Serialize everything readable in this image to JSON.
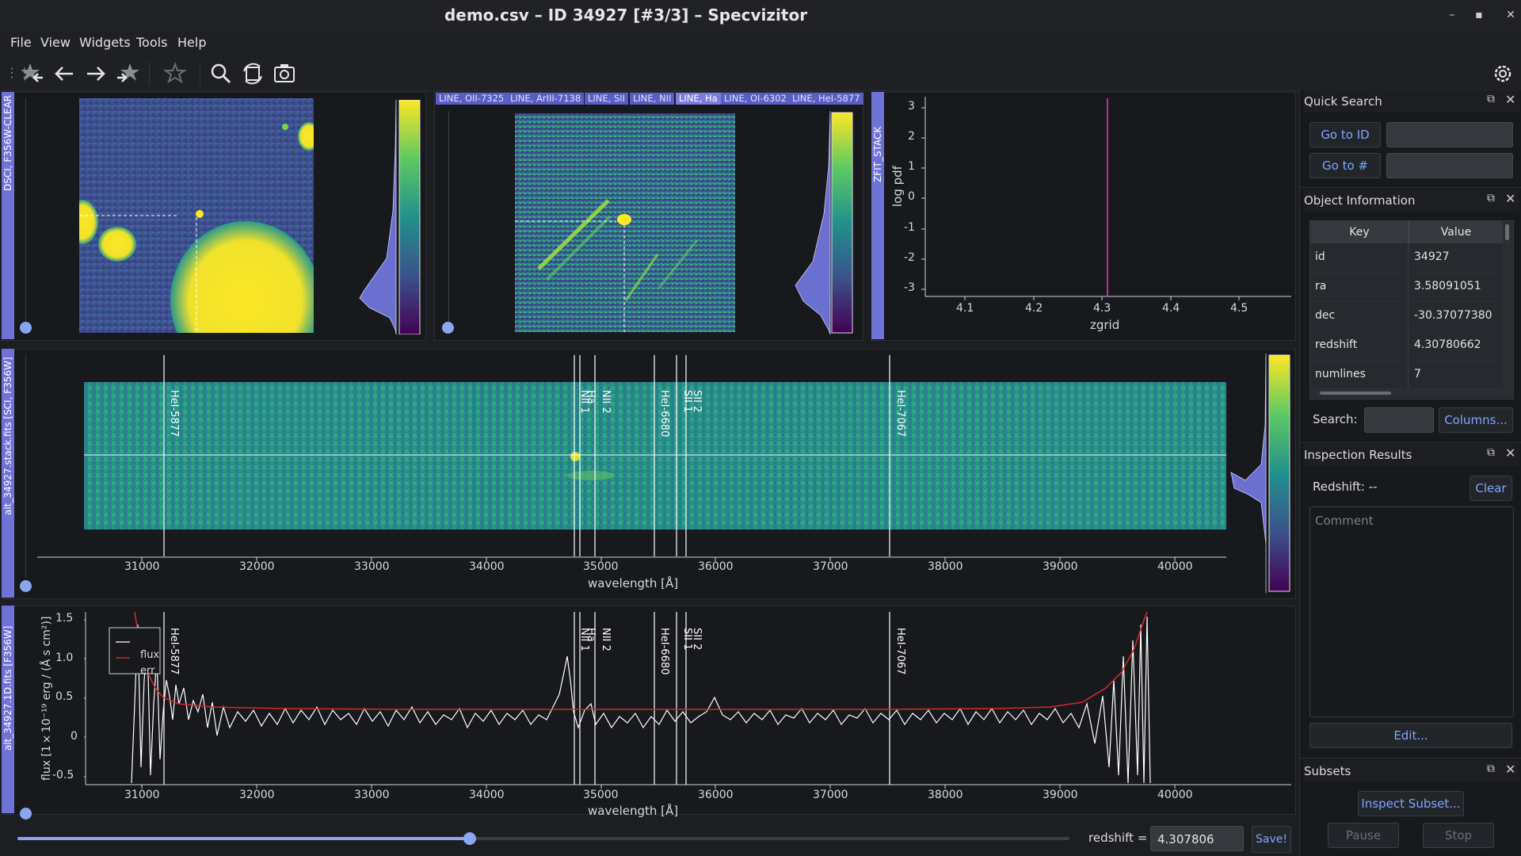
{
  "window": {
    "title": "demo.csv – ID 34927 [#3/3] – Specvizitor"
  },
  "menu": [
    "File",
    "View",
    "Widgets",
    "Tools",
    "Help"
  ],
  "toolbar": {
    "icons": [
      "first-star-icon",
      "back-icon",
      "forward-icon",
      "last-star-icon",
      "star-icon",
      "search-icon",
      "reset-view-icon",
      "screenshot-icon",
      "settings-icon"
    ]
  },
  "image1": {
    "label": "DSCI, F356W-CLEAR"
  },
  "image2": {
    "tabs": [
      "LINE, OII-7325",
      "LINE, ArIII-7138",
      "LINE, SII",
      "LINE, NII",
      "LINE, Ha",
      "LINE, OI-6302",
      "LINE, HeI-5877"
    ],
    "active_tab": "LINE, Ha"
  },
  "zfit": {
    "label": "ZFIT_STACK",
    "ylabel": "log pdf",
    "xlabel": "zgrid",
    "yticks": [
      "3",
      "2",
      "1",
      "0",
      "-1",
      "-2",
      "-3"
    ],
    "xticks": [
      "4.1",
      "4.2",
      "4.3",
      "4.4",
      "4.5"
    ]
  },
  "spec2d": {
    "label": "alt_34927.stack.fits [SCI, F356W]",
    "xlabel": "wavelength [Å]",
    "xticks": [
      "31000",
      "32000",
      "33000",
      "34000",
      "35000",
      "36000",
      "37000",
      "38000",
      "39000",
      "40000"
    ],
    "lines": [
      "HeI-5877",
      "NII 1",
      "Ha",
      "NII 2",
      "HeI-6680",
      "SII 1",
      "SII 2",
      "HeI-7067"
    ]
  },
  "spec1d": {
    "label": "alt_34927.1D.fits [F356W]",
    "ylabel": "flux [1×10⁻¹⁹ erg / (Å s cm²)]",
    "xlabel": "wavelength [Å]",
    "yticks": [
      "1.5",
      "1.0",
      "0.5",
      "0",
      "-0.5"
    ],
    "xticks": [
      "31000",
      "32000",
      "33000",
      "34000",
      "35000",
      "36000",
      "37000",
      "38000",
      "39000",
      "40000"
    ],
    "legend": [
      "flux",
      "err"
    ],
    "lines": [
      "HeI-5877",
      "NII 1",
      "Ha",
      "NII 2",
      "HeI-6680",
      "SII 1",
      "SII 2",
      "HeI-7067"
    ]
  },
  "bottom": {
    "redshift_label": "redshift =",
    "redshift_value": "4.307806",
    "save_label": "Save!",
    "slider_fraction": 0.43
  },
  "quick_search": {
    "title": "Quick Search",
    "goto_id": "Go to ID",
    "goto_num": "Go to #"
  },
  "object_info": {
    "title": "Object Information",
    "headers": [
      "Key",
      "Value"
    ],
    "rows": [
      [
        "id",
        "34927"
      ],
      [
        "ra",
        "3.58091051"
      ],
      [
        "dec",
        "-30.37077380"
      ],
      [
        "redshift",
        "4.30780662"
      ],
      [
        "numlines",
        "7"
      ]
    ],
    "search_label": "Search:",
    "columns_button": "Columns..."
  },
  "inspection": {
    "title": "Inspection Results",
    "redshift_text": "Redshift: --",
    "clear_button": "Clear",
    "comment_placeholder": "Comment",
    "edit_button": "Edit..."
  },
  "subsets": {
    "title": "Subsets",
    "inspect_button": "Inspect Subset...",
    "pause_button": "Pause",
    "stop_button": "Stop"
  },
  "colors": {
    "accent": "#6f72d6",
    "link": "#7fa6ff",
    "err_line": "#d42a2a",
    "pdf_line": "#e040c0"
  }
}
